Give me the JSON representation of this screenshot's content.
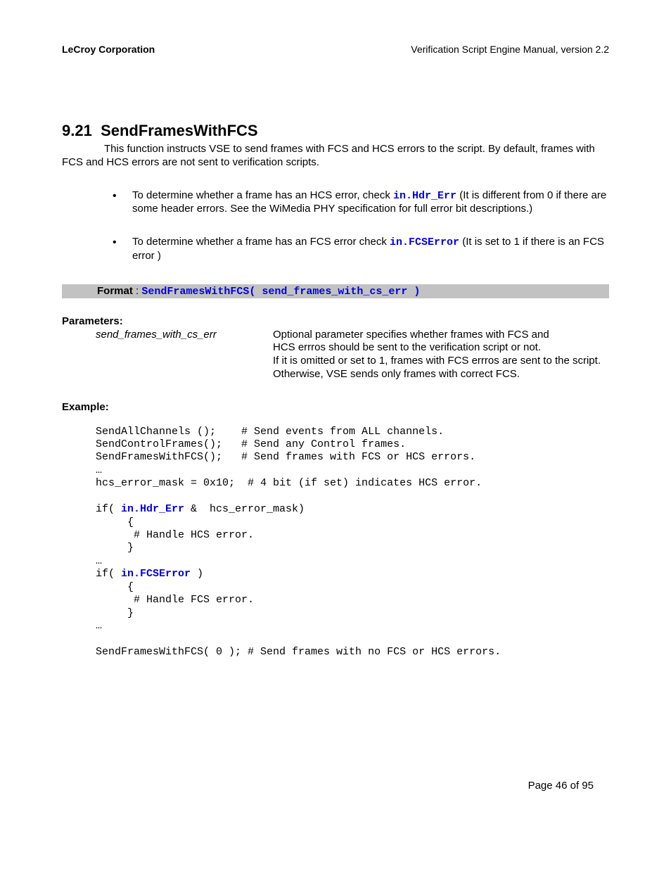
{
  "header": {
    "left": "LeCroy Corporation",
    "right": "Verification Script Engine Manual, version 2.2"
  },
  "section": {
    "number": "9.21",
    "title": "SendFramesWithFCS",
    "intro": "This function instructs VSE to send frames with FCS and HCS errors to the script. By default, frames with FCS and HCS errors are not sent to verification scripts."
  },
  "bullets": [
    {
      "pre": "To determine whether a frame has an HCS error, check ",
      "code": "in.Hdr_Err",
      "post": " (It is different from 0 if there are some header errors. See the WiMedia PHY specification for full error bit descriptions.)"
    },
    {
      "pre": "To determine whether a frame has an FCS error check ",
      "code": "in.FCSError",
      "post": " (It is set to 1 if there is an FCS error )"
    }
  ],
  "format": {
    "label": "Format",
    "sep": " : ",
    "code": "SendFramesWithFCS( send_frames_with_cs_err )"
  },
  "parameters": {
    "heading": "Parameters:",
    "name": "send_frames_with_cs_err",
    "desc_lines": [
      "Optional parameter specifies whether frames with FCS and",
      "HCS errros should be sent to the verification script or not.",
      "If it is omitted or set to 1, frames with FCS errros are sent to the script.",
      "Otherwise, VSE sends only frames with correct FCS."
    ]
  },
  "example": {
    "heading": "Example:",
    "lines": [
      {
        "plain": "SendAllChannels ();    # Send events from ALL channels."
      },
      {
        "plain": "SendControlFrames();   # Send any Control frames."
      },
      {
        "plain": "SendFramesWithFCS();   # Send frames with FCS or HCS errors."
      },
      {
        "plain": "…"
      },
      {
        "plain": "hcs_error_mask = 0x10;  # 4 bit (if set) indicates HCS error."
      },
      {
        "plain": ""
      },
      {
        "plain": "if( ",
        "blue": "in.Hdr_Err",
        "post": " &  hcs_error_mask)"
      },
      {
        "plain": "     {"
      },
      {
        "plain": "      # Handle HCS error."
      },
      {
        "plain": "     }"
      },
      {
        "plain": "…"
      },
      {
        "plain": "if( ",
        "blue": "in.FCSError",
        "post": " )"
      },
      {
        "plain": "     {"
      },
      {
        "plain": "      # Handle FCS error."
      },
      {
        "plain": "     }"
      },
      {
        "plain": "…"
      },
      {
        "plain": ""
      },
      {
        "plain": "SendFramesWithFCS( 0 ); # Send frames with no FCS or HCS errors."
      }
    ]
  },
  "footer": {
    "page": "Page 46 of 95"
  }
}
